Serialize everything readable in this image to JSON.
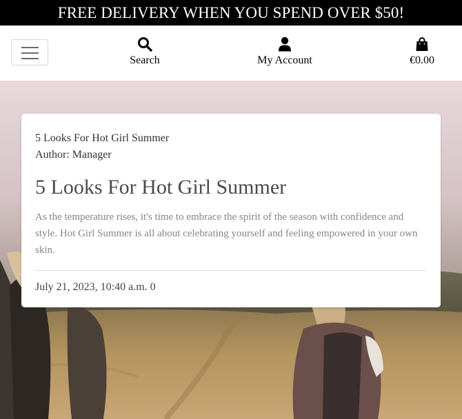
{
  "banner": {
    "text": "FREE DELIVERY WHEN YOU SPEND OVER $50!"
  },
  "nav": {
    "search_label": "Search",
    "account_label": "My Account",
    "bag_total": "€0.00"
  },
  "post": {
    "breadcrumb_title": "5 Looks For Hot Girl Summer",
    "author_line": "Author: Manager",
    "title": "5 Looks For Hot Girl Summer",
    "excerpt": "As the temperature rises, it's time to embrace the spirit of the season with confidence and style. Hot Girl Summer is all about celebrating yourself and feeling empowered in your own skin.",
    "footer": "July 21, 2023, 10:40 a.m. 0"
  },
  "icons": {
    "menu": "hamburger-menu-icon",
    "search": "search-icon",
    "account": "user-icon",
    "bag": "shopping-bag-icon"
  },
  "colors": {
    "banner_bg": "#000000",
    "banner_text": "#ffffff",
    "title_text": "#4a4a4a",
    "excerpt_text": "#858585"
  }
}
